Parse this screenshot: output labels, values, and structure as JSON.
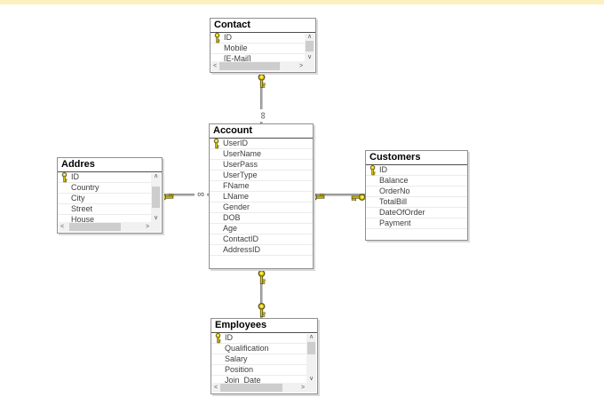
{
  "page": {
    "top_bar_color": "#fbf1c0",
    "background": "#ffffff"
  },
  "diagram": {
    "tables": [
      {
        "title": "Contact",
        "columns": [
          {
            "name": "ID",
            "key": true
          },
          {
            "name": "Mobile",
            "key": false
          },
          {
            "name": "[E-Mail]",
            "key": false
          }
        ],
        "has_vertical_scrollbar": true,
        "has_horizontal_scrollbar": true
      },
      {
        "title": "Addres",
        "columns": [
          {
            "name": "ID",
            "key": true
          },
          {
            "name": "Country",
            "key": false
          },
          {
            "name": "City",
            "key": false
          },
          {
            "name": "Street",
            "key": false
          },
          {
            "name": "House",
            "key": false
          }
        ],
        "has_vertical_scrollbar": true,
        "has_horizontal_scrollbar": true
      },
      {
        "title": "Account",
        "columns": [
          {
            "name": "UserID",
            "key": true
          },
          {
            "name": "UserName",
            "key": false
          },
          {
            "name": "UserPass",
            "key": false
          },
          {
            "name": "UserType",
            "key": false
          },
          {
            "name": "FName",
            "key": false
          },
          {
            "name": "LName",
            "key": false
          },
          {
            "name": "Gender",
            "key": false
          },
          {
            "name": "DOB",
            "key": false
          },
          {
            "name": "Age",
            "key": false
          },
          {
            "name": "ContactID",
            "key": false
          },
          {
            "name": "AddressID",
            "key": false
          }
        ],
        "has_vertical_scrollbar": false,
        "has_horizontal_scrollbar": false
      },
      {
        "title": "Customers",
        "columns": [
          {
            "name": "ID",
            "key": true
          },
          {
            "name": "Balance",
            "key": false
          },
          {
            "name": "OrderNo",
            "key": false
          },
          {
            "name": "TotalBill",
            "key": false
          },
          {
            "name": "DateOfOrder",
            "key": false
          },
          {
            "name": "Payment",
            "key": false
          }
        ],
        "has_vertical_scrollbar": false,
        "has_horizontal_scrollbar": false
      },
      {
        "title": "Employees",
        "columns": [
          {
            "name": "ID",
            "key": true
          },
          {
            "name": "Qualification",
            "key": false
          },
          {
            "name": "Salary",
            "key": false
          },
          {
            "name": "Position",
            "key": false
          },
          {
            "name": "Join_Date",
            "key": false
          }
        ],
        "has_vertical_scrollbar": true,
        "has_horizontal_scrollbar": true
      }
    ],
    "relationships": [
      {
        "from": "Contact",
        "to": "Account",
        "cardinality": "one-to-many",
        "from_icon": "key-icon",
        "to_icon": "infinity-icon"
      },
      {
        "from": "Addres",
        "to": "Account",
        "cardinality": "one-to-many",
        "from_icon": "key-icon",
        "to_icon": "infinity-icon"
      },
      {
        "from": "Account",
        "to": "Customers",
        "cardinality": "one-to-one",
        "from_icon": "key-icon",
        "to_icon": "key-icon"
      },
      {
        "from": "Account",
        "to": "Employees",
        "cardinality": "one-to-one",
        "from_icon": "key-icon",
        "to_icon": "key-icon"
      }
    ],
    "icons": {
      "infinity": "∞",
      "scroll_up": "∧",
      "scroll_down": "∨",
      "scroll_left": "<",
      "scroll_right": ">",
      "key_color": "#e3cf00"
    }
  }
}
